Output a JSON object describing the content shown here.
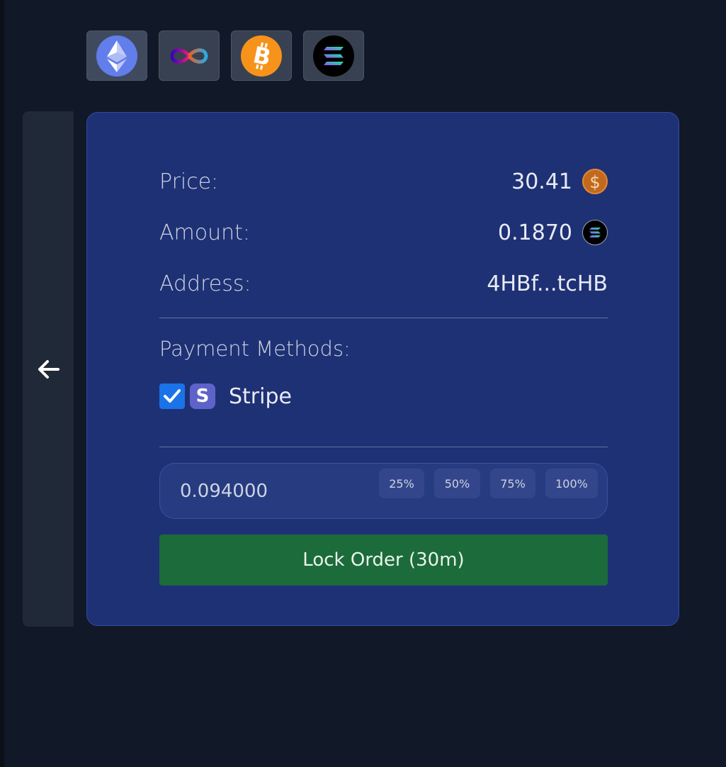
{
  "chains": [
    {
      "icon": "ethereum-icon",
      "selected": true
    },
    {
      "icon": "internet-computer-icon",
      "selected": false
    },
    {
      "icon": "bitcoin-icon",
      "selected": false
    },
    {
      "icon": "solana-icon",
      "selected": false
    }
  ],
  "back": {
    "icon": "arrow-left-icon"
  },
  "order": {
    "price_label": "Price:",
    "price_value": "30.41",
    "price_coin_icon": "dollar-coin-icon",
    "amount_label": "Amount:",
    "amount_value": "0.1870",
    "amount_coin_icon": "solana-icon",
    "address_label": "Address:",
    "address_value": "4HBf...tcHB"
  },
  "payment": {
    "label": "Payment Methods:",
    "methods": [
      {
        "name": "Stripe",
        "checked": true,
        "logo_letter": "S"
      }
    ]
  },
  "amount_input": {
    "value": "0.094000",
    "percent_buttons": [
      "25%",
      "50%",
      "75%",
      "100%"
    ]
  },
  "lock_button": {
    "label": "Lock Order (30m)"
  },
  "colors": {
    "background": "#111827",
    "card": "#1e3175",
    "lock_button": "#1c6b3a",
    "checkbox": "#1a73e8",
    "stripe": "#5e63c9"
  }
}
